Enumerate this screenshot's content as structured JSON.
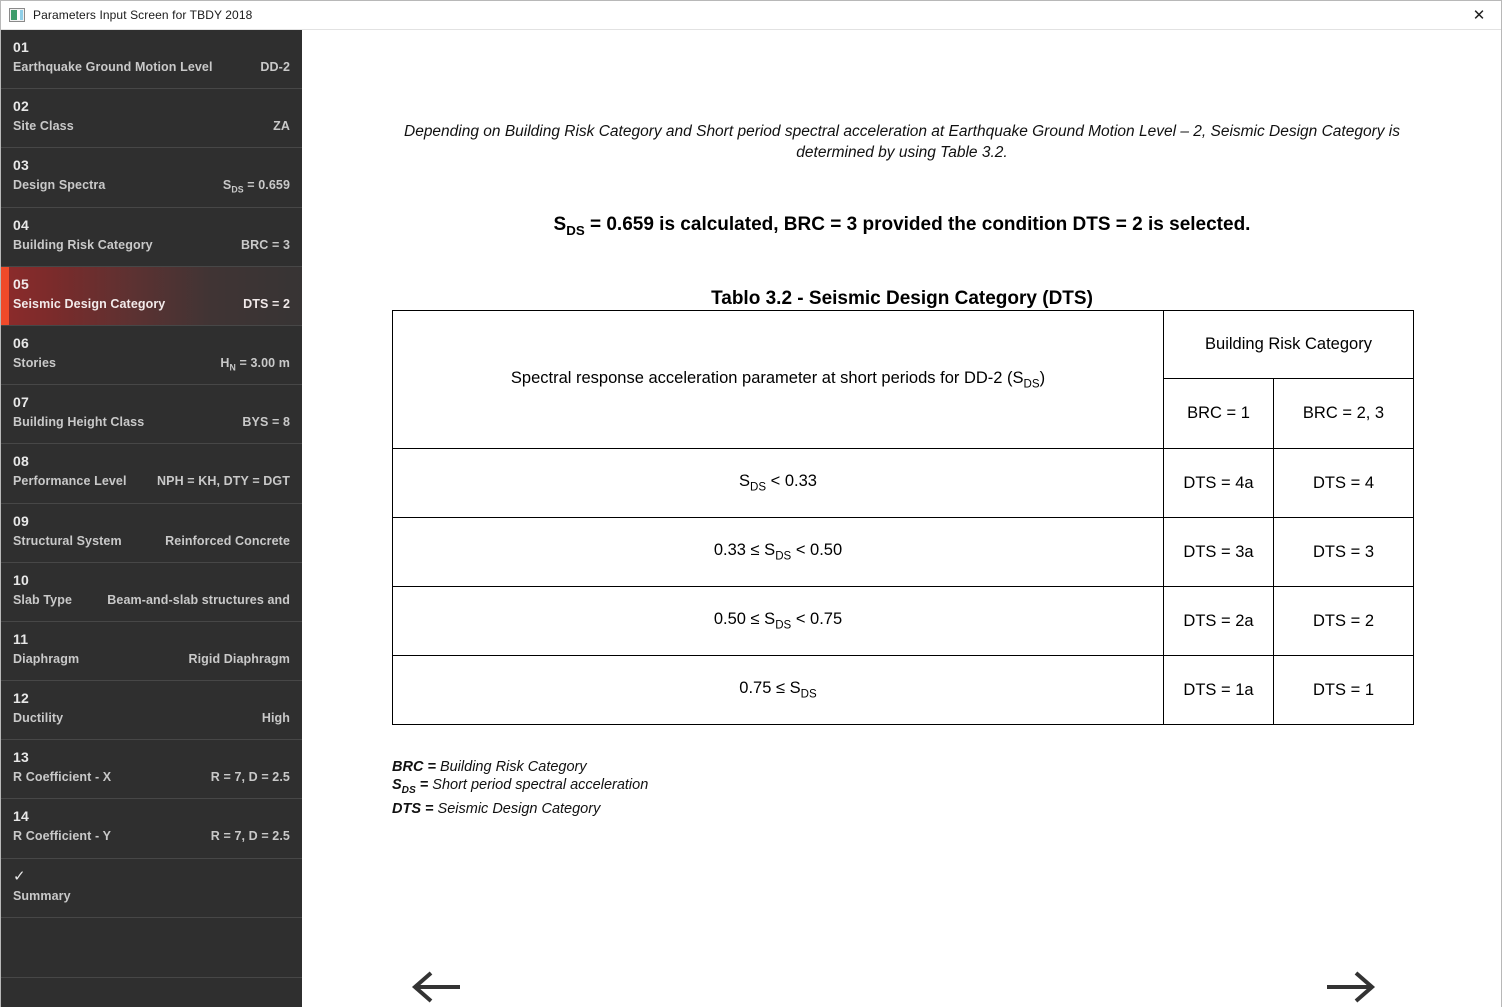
{
  "window": {
    "title": "Parameters Input Screen for TBDY 2018",
    "icon": "app-window-icon",
    "close_label": "✕"
  },
  "sidebar": {
    "items": [
      {
        "num": "01",
        "label": "Earthquake Ground Motion Level",
        "value": "DD-2",
        "active": false
      },
      {
        "num": "02",
        "label": "Site Class",
        "value": "ZA",
        "active": false
      },
      {
        "num": "03",
        "label": "Design Spectra",
        "value": "SDs = 0.659",
        "value_html": "S<sub>DS</sub> = 0.659",
        "active": false
      },
      {
        "num": "04",
        "label": "Building Risk Category",
        "value": "BRC = 3",
        "active": false
      },
      {
        "num": "05",
        "label": "Seismic Design Category",
        "value": "DTS = 2",
        "active": true
      },
      {
        "num": "06",
        "label": "Stories",
        "value": "HN = 3.00 m",
        "value_html": "H<sub>N</sub> = 3.00 m",
        "active": false
      },
      {
        "num": "07",
        "label": "Building Height Class",
        "value": "BYS = 8",
        "active": false
      },
      {
        "num": "08",
        "label": "Performance Level",
        "value": "NPH = KH, DTY = DGT",
        "active": false
      },
      {
        "num": "09",
        "label": "Structural System",
        "value": "Reinforced Concrete",
        "active": false
      },
      {
        "num": "10",
        "label": "Slab Type",
        "value": "Beam-and-slab structures and",
        "active": false
      },
      {
        "num": "11",
        "label": "Diaphragm",
        "value": "Rigid Diaphragm",
        "active": false
      },
      {
        "num": "12",
        "label": "Ductility",
        "value": "High",
        "active": false
      },
      {
        "num": "13",
        "label": "R Coefficient - X",
        "value": "R = 7, D = 2.5",
        "active": false
      },
      {
        "num": "14",
        "label": "R Coefficient - Y",
        "value": "R = 7, D = 2.5",
        "active": false
      },
      {
        "num": "✓",
        "label": "Summary",
        "value": "",
        "active": false
      }
    ]
  },
  "main": {
    "intro_text": "Depending on Building Risk Category and Short period spectral acceleration at Earthquake Ground Motion Level – 2, Seismic Design Category is determined by using Table 3.2.",
    "calc_text_html": "S<sub>DS</sub> = 0.659 is calculated, BRC = 3 provided the condition DTS = 2 is selected.",
    "table_title": "Tablo 3.2 - Seismic Design Category (DTS)",
    "table": {
      "header_desc_html": "Spectral response acceleration parameter at short periods for DD-2 (S<sub>DS</sub>)",
      "header_group": "Building Risk Category",
      "header_col1": "BRC = 1",
      "header_col2": "BRC = 2, 3",
      "rows": [
        {
          "desc_html": "S<sub>DS</sub> &lt; 0.33",
          "brc1": "DTS = 4a",
          "brc23": "DTS = 4",
          "highlighted": false
        },
        {
          "desc_html": "0.33 ≤ S<sub>DS</sub> &lt; 0.50",
          "brc1": "DTS = 3a",
          "brc23": "DTS = 3",
          "highlighted": false
        },
        {
          "desc_html": "0.50 ≤ S<sub>DS</sub> &lt; 0.75",
          "brc1": "DTS = 2a",
          "brc23": "DTS = 2",
          "highlighted": true
        },
        {
          "desc_html": "0.75 ≤ S<sub>DS</sub>",
          "brc1": "DTS = 1a",
          "brc23": "DTS = 1",
          "highlighted": false
        }
      ]
    },
    "legend": [
      {
        "key": "BRC =",
        "value": "Building Risk Category"
      },
      {
        "key_html": "S<sub>DS</sub> =",
        "value": "Short period spectral acceleration"
      },
      {
        "key": "DTS =",
        "value": "Seismic Design Category"
      }
    ],
    "nav": {
      "prev_icon": "arrow-left-icon",
      "next_icon": "arrow-right-icon"
    }
  },
  "colors": {
    "sidebar_bg": "#2f2f2f",
    "active_accent": "#f04a2a",
    "active_gradient_start": "#8d2b2b",
    "row_highlight": "#fbd3c2",
    "table_border": "#000000"
  }
}
